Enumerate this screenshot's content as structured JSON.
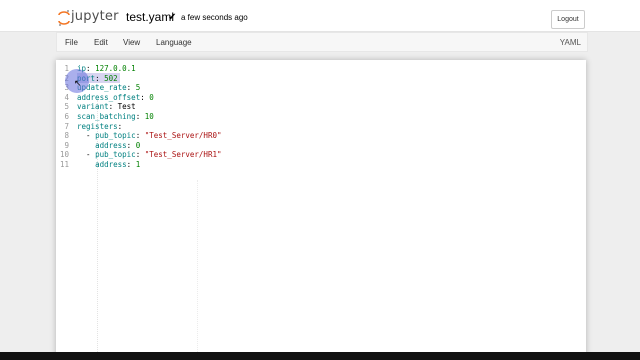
{
  "header": {
    "logo_text": "jupyter",
    "filename": "test.yaml",
    "check": "✔",
    "save_status": "a few seconds ago",
    "logout_label": "Logout"
  },
  "menubar": {
    "items": [
      "File",
      "Edit",
      "View",
      "Language"
    ],
    "mode": "YAML"
  },
  "editor": {
    "lines": [
      {
        "n": "1",
        "tokens": [
          [
            "k",
            "ip"
          ],
          [
            "p",
            ": "
          ],
          [
            "num",
            "127.0.0.1"
          ]
        ]
      },
      {
        "n": "2",
        "tokens": [
          [
            "k",
            "port"
          ],
          [
            "p",
            ": "
          ],
          [
            "num",
            "502"
          ]
        ]
      },
      {
        "n": "3",
        "tokens": [
          [
            "k",
            "update_rate"
          ],
          [
            "p",
            ": "
          ],
          [
            "num",
            "5"
          ]
        ]
      },
      {
        "n": "4",
        "tokens": [
          [
            "k",
            "address_offset"
          ],
          [
            "p",
            ": "
          ],
          [
            "num",
            "0"
          ]
        ]
      },
      {
        "n": "5",
        "tokens": [
          [
            "k",
            "variant"
          ],
          [
            "p",
            ": "
          ],
          [
            "plain",
            "Test"
          ]
        ]
      },
      {
        "n": "6",
        "tokens": [
          [
            "k",
            "scan_batching"
          ],
          [
            "p",
            ": "
          ],
          [
            "num",
            "10"
          ]
        ]
      },
      {
        "n": "7",
        "tokens": [
          [
            "k",
            "registers"
          ],
          [
            "p",
            ":"
          ]
        ]
      },
      {
        "n": "8",
        "tokens": [
          [
            "p",
            "  - "
          ],
          [
            "k",
            "pub_topic"
          ],
          [
            "p",
            ": "
          ],
          [
            "str",
            "\"Test_Server/HR0\""
          ]
        ]
      },
      {
        "n": "9",
        "tokens": [
          [
            "p",
            "    "
          ],
          [
            "k",
            "address"
          ],
          [
            "p",
            ": "
          ],
          [
            "num",
            "0"
          ]
        ]
      },
      {
        "n": "10",
        "tokens": [
          [
            "p",
            "  - "
          ],
          [
            "k",
            "pub_topic"
          ],
          [
            "p",
            ": "
          ],
          [
            "str",
            "\"Test_Server/HR1\""
          ]
        ]
      },
      {
        "n": "11",
        "tokens": [
          [
            "p",
            "    "
          ],
          [
            "k",
            "address"
          ],
          [
            "p",
            ": "
          ],
          [
            "num",
            "1"
          ]
        ]
      }
    ]
  },
  "colors": {
    "key": "#008080",
    "number": "#008000",
    "string": "#aa1111",
    "selection": "#d7d4f0",
    "click_highlight": "#646edc"
  },
  "icons": {
    "logo": "jupyter-logo-icon",
    "saved": "checkmark-icon",
    "cursor": "mouse-pointer-icon"
  }
}
